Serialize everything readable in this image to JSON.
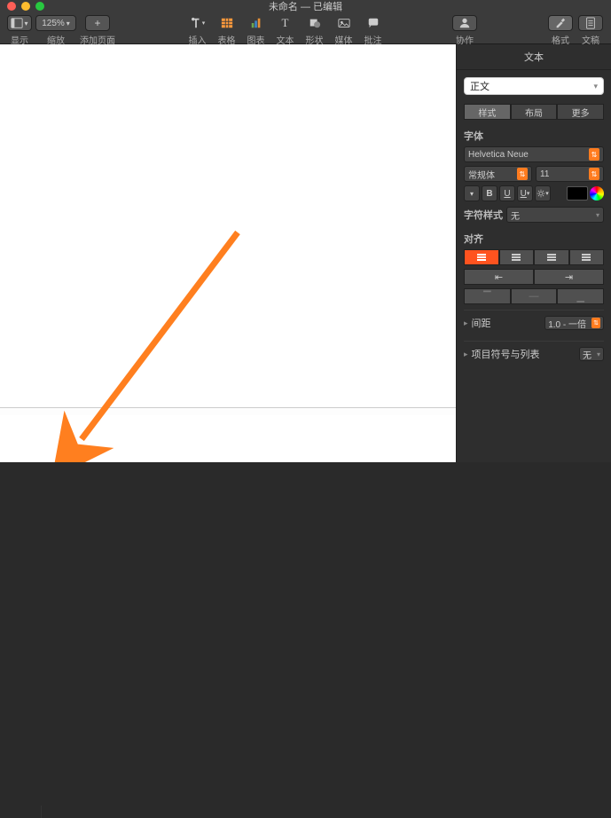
{
  "window": {
    "title": "未命名 — 已编辑"
  },
  "toolbar_left": {
    "view_label": "显示",
    "zoom_value": "125%",
    "zoom_label": "缩放",
    "addpage_label": "添加页面"
  },
  "toolbar_center": {
    "insert": "插入",
    "table": "表格",
    "chart": "图表",
    "text": "文本",
    "shape": "形状",
    "media": "媒体",
    "comment": "批注"
  },
  "toolbar_right": {
    "collab": "协作",
    "format": "格式",
    "document": "文稿"
  },
  "inspector": {
    "tab": "文本",
    "paragraph_style": "正文",
    "seg": {
      "style": "样式",
      "layout": "布局",
      "more": "更多"
    },
    "font_label": "字体",
    "font_family": "Helvetica Neue",
    "font_weight": "常规体",
    "font_size": "11",
    "char_style_label": "字符样式",
    "char_style_value": "无",
    "align_label": "对齐",
    "spacing_label": "间距",
    "spacing_value": "1.0 - 一倍",
    "bullets_label": "项目符号与列表",
    "bullets_value": "无"
  }
}
